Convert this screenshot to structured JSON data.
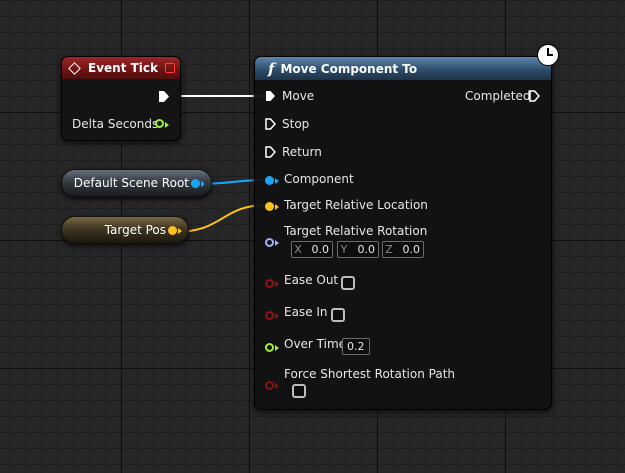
{
  "event_tick": {
    "title": "Event Tick",
    "delta_label": "Delta Seconds"
  },
  "getters": {
    "default_scene_root": "Default Scene Root",
    "target_pos": "Target Pos"
  },
  "move_component": {
    "title": "Move Component To",
    "exec_inputs": [
      "Move",
      "Stop",
      "Return"
    ],
    "exec_output": "Completed",
    "component_label": "Component",
    "target_location_label": "Target Relative Location",
    "target_rotation_label": "Target Relative Rotation",
    "rotation": {
      "x_axis": "X",
      "x_value": "0.0",
      "y_axis": "Y",
      "y_value": "0.0",
      "z_axis": "Z",
      "z_value": "0.0"
    },
    "ease_out_label": "Ease Out",
    "ease_in_label": "Ease In",
    "over_time_label": "Over Time",
    "over_time_value": "0.2",
    "force_shortest_label": "Force Shortest Rotation Path"
  },
  "colors": {
    "float_pin": "#9ef03c",
    "object_pin": "#1aa6ff",
    "vector_pin": "#f9c31c",
    "rotator_pin": "#9fb0ff",
    "bool_pin": "#8e1212",
    "exec_wire": "#ffffff"
  }
}
